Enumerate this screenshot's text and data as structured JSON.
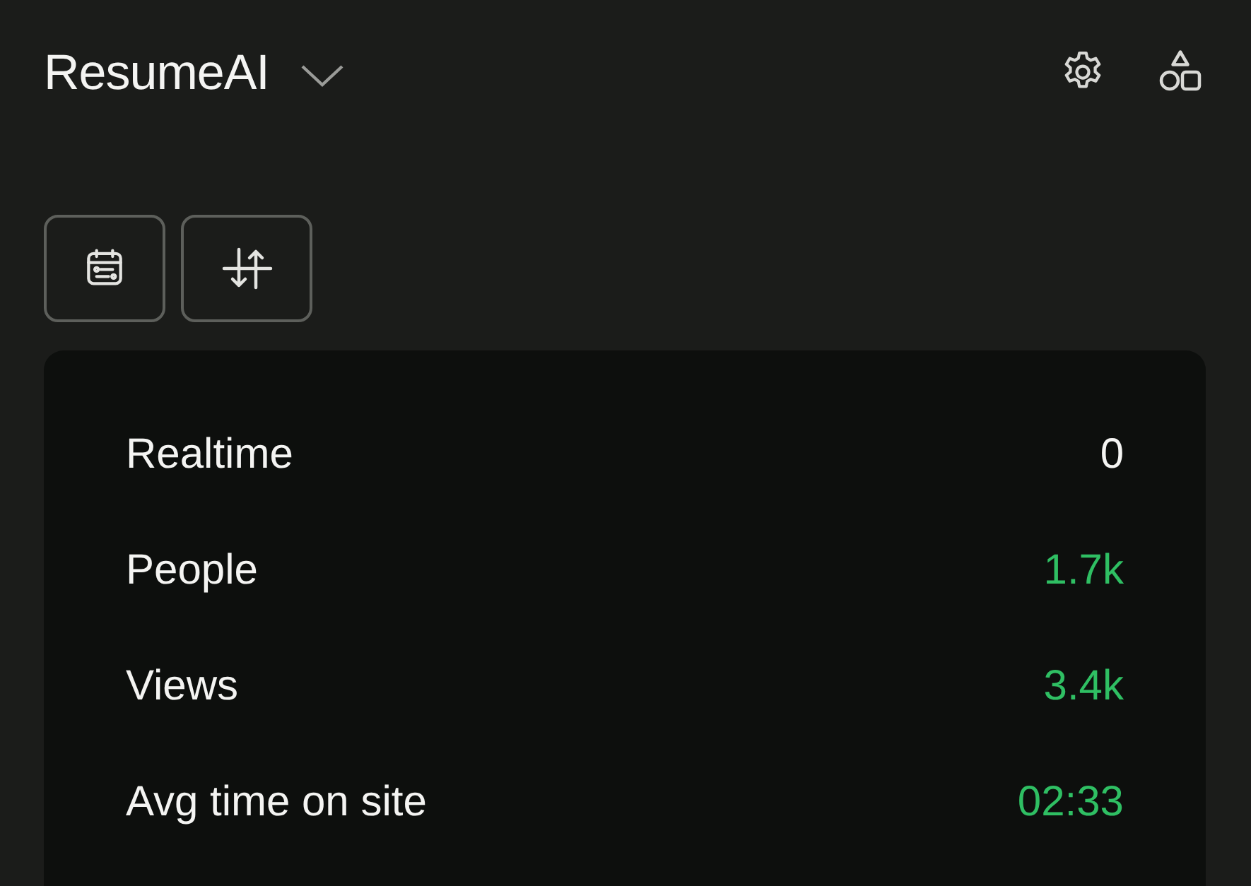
{
  "header": {
    "title": "ResumeAI"
  },
  "stats": [
    {
      "label": "Realtime",
      "value": "0",
      "color": "#f4f4f2"
    },
    {
      "label": "People",
      "value": "1.7k",
      "color": "#2fbf63"
    },
    {
      "label": "Views",
      "value": "3.4k",
      "color": "#2fbf63"
    },
    {
      "label": "Avg time on site",
      "value": "02:33",
      "color": "#2fbf63"
    }
  ]
}
